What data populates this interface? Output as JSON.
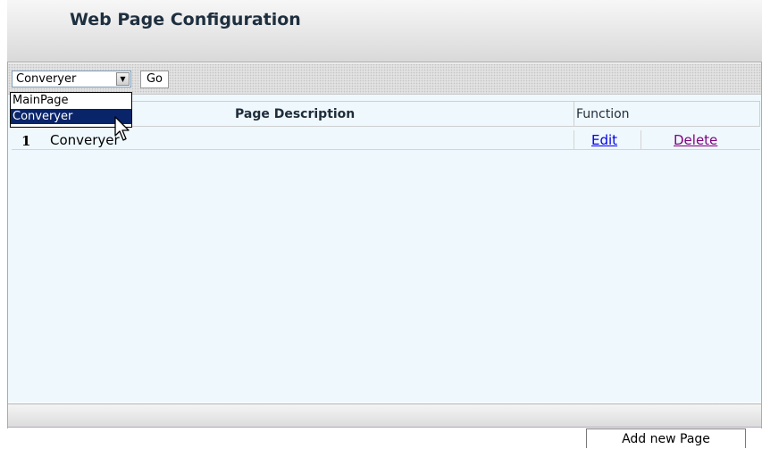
{
  "page": {
    "title": "Web Page Configuration"
  },
  "toolbar": {
    "select_value": "Converyer",
    "go_label": "Go",
    "options": [
      "MainPage",
      "Converyer"
    ]
  },
  "table": {
    "headers": {
      "description": "Page Description",
      "function": "Function"
    },
    "rows": [
      {
        "num": "1",
        "name": "Converyer",
        "edit": "Edit",
        "delete": "Delete"
      }
    ]
  },
  "footer": {
    "add_button": "Add new Page"
  },
  "colors": {
    "title": "#1e2f3f",
    "content_bg": "#eff8fd",
    "selection": "#0a246a",
    "link": "#0000ee",
    "visited_link": "#800080"
  },
  "icons": {
    "cursor": "arrow-cursor-icon",
    "dropdown_arrow": "chevron-down-icon"
  }
}
